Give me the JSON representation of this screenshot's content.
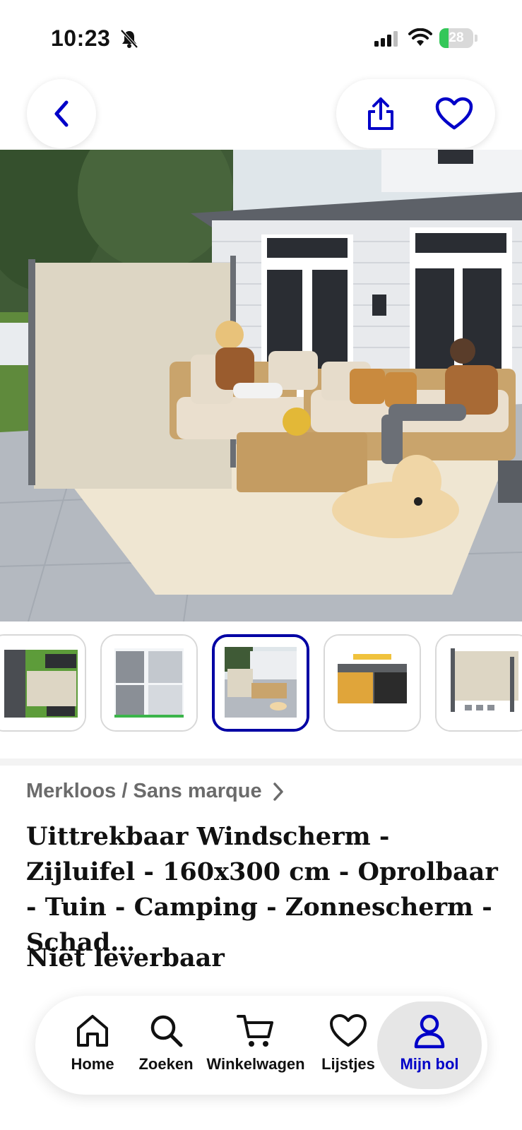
{
  "status_bar": {
    "time": "10:23",
    "battery_level": "28",
    "battery_fraction": 0.28
  },
  "header": {
    "back_icon": "chevron-left-icon",
    "share_icon": "share-icon",
    "favorite_icon": "heart-icon"
  },
  "gallery": {
    "selected_index": 2,
    "thumbnail_count": 5
  },
  "product": {
    "brand": "Merkloos / Sans marque",
    "title": "Uittrekbaar Windscherm - Zijluifel - 160x300 cm - Oprolbaar - Tuin - Camping - Zonnescherm - Schad…",
    "availability": "Niet leverbaar"
  },
  "tabbar": {
    "tabs": [
      {
        "label": "Home",
        "icon": "home-icon"
      },
      {
        "label": "Zoeken",
        "icon": "search-icon"
      },
      {
        "label": "Winkelwagen",
        "icon": "cart-icon"
      },
      {
        "label": "Lijstjes",
        "icon": "heart-icon"
      },
      {
        "label": "Mijn bol",
        "icon": "user-icon"
      }
    ],
    "active_index": 4
  },
  "colors": {
    "accent": "#0000c8",
    "battery": "#34c759",
    "text_muted": "#6b6b6b"
  }
}
